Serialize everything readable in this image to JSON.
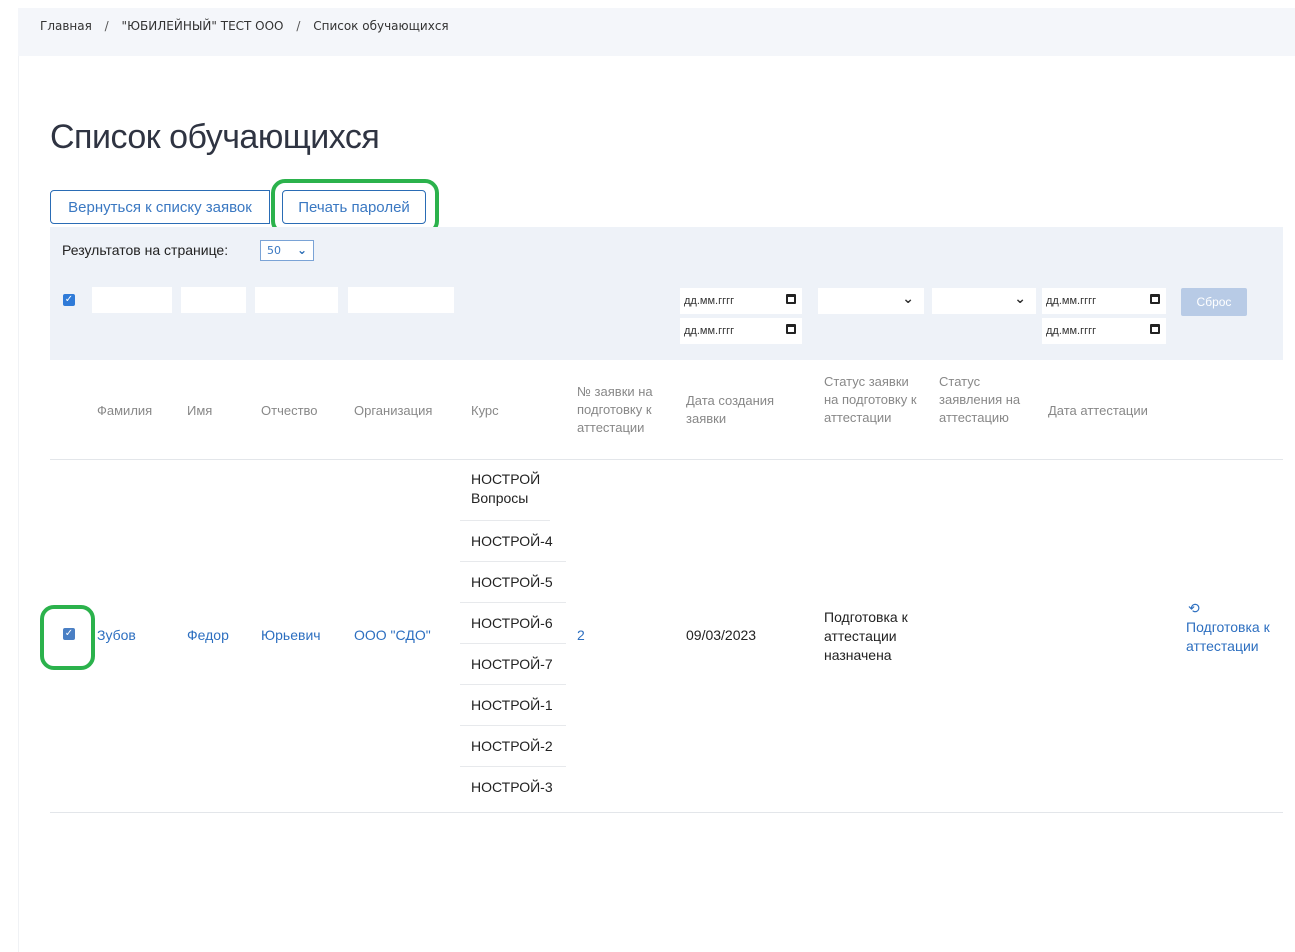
{
  "breadcrumb": {
    "items": [
      "Главная",
      "\"ЮБИЛЕЙНЫЙ\" ТЕСТ ООО",
      "Список обучающихся"
    ],
    "separator": "/"
  },
  "page_title": "Список обучающихся",
  "buttons": {
    "back": "Вернуться к списку заявок",
    "print": "Печать паролей",
    "reset": "Сброс"
  },
  "per_page": {
    "label": "Результатов на странице:",
    "value": "50"
  },
  "filters": {
    "date_placeholder": "дд.мм.гггг"
  },
  "columns": {
    "surname": "Фамилия",
    "name": "Имя",
    "patronymic": "Отчество",
    "organization": "Организация",
    "course": "Курс",
    "app_number": "№ заявки на подготовку к аттестации",
    "created_date": "Дата создания заявки",
    "app_status": "Статус заявки на подготовку к аттестации",
    "statement_status": "Статус заявления на аттестацию",
    "attestation_date": "Дата аттестации"
  },
  "row": {
    "surname": "Зубов",
    "name": "Федор",
    "patronymic": "Юрьевич",
    "organization": "ООО \"СДО\"",
    "courses": [
      "НОСТРОЙ Вопросы",
      "НОСТРОЙ-4",
      "НОСТРОЙ-5",
      "НОСТРОЙ-6",
      "НОСТРОЙ-7",
      "НОСТРОЙ-1",
      "НОСТРОЙ-2",
      "НОСТРОЙ-3"
    ],
    "app_number": "2",
    "created_date": "09/03/2023",
    "app_status": "Подготовка к аттестации назначена",
    "action": "Подготовка к аттестации"
  },
  "colors": {
    "accent": "#2d6fc0",
    "highlight": "#2bb24c",
    "filter_bg": "#eef2f8",
    "reset_bg": "#b8cbe6"
  },
  "icons": {
    "checkbox": "check-icon",
    "calendar": "calendar-icon",
    "dropdown": "chevron-down-icon",
    "action": "undo-icon"
  }
}
